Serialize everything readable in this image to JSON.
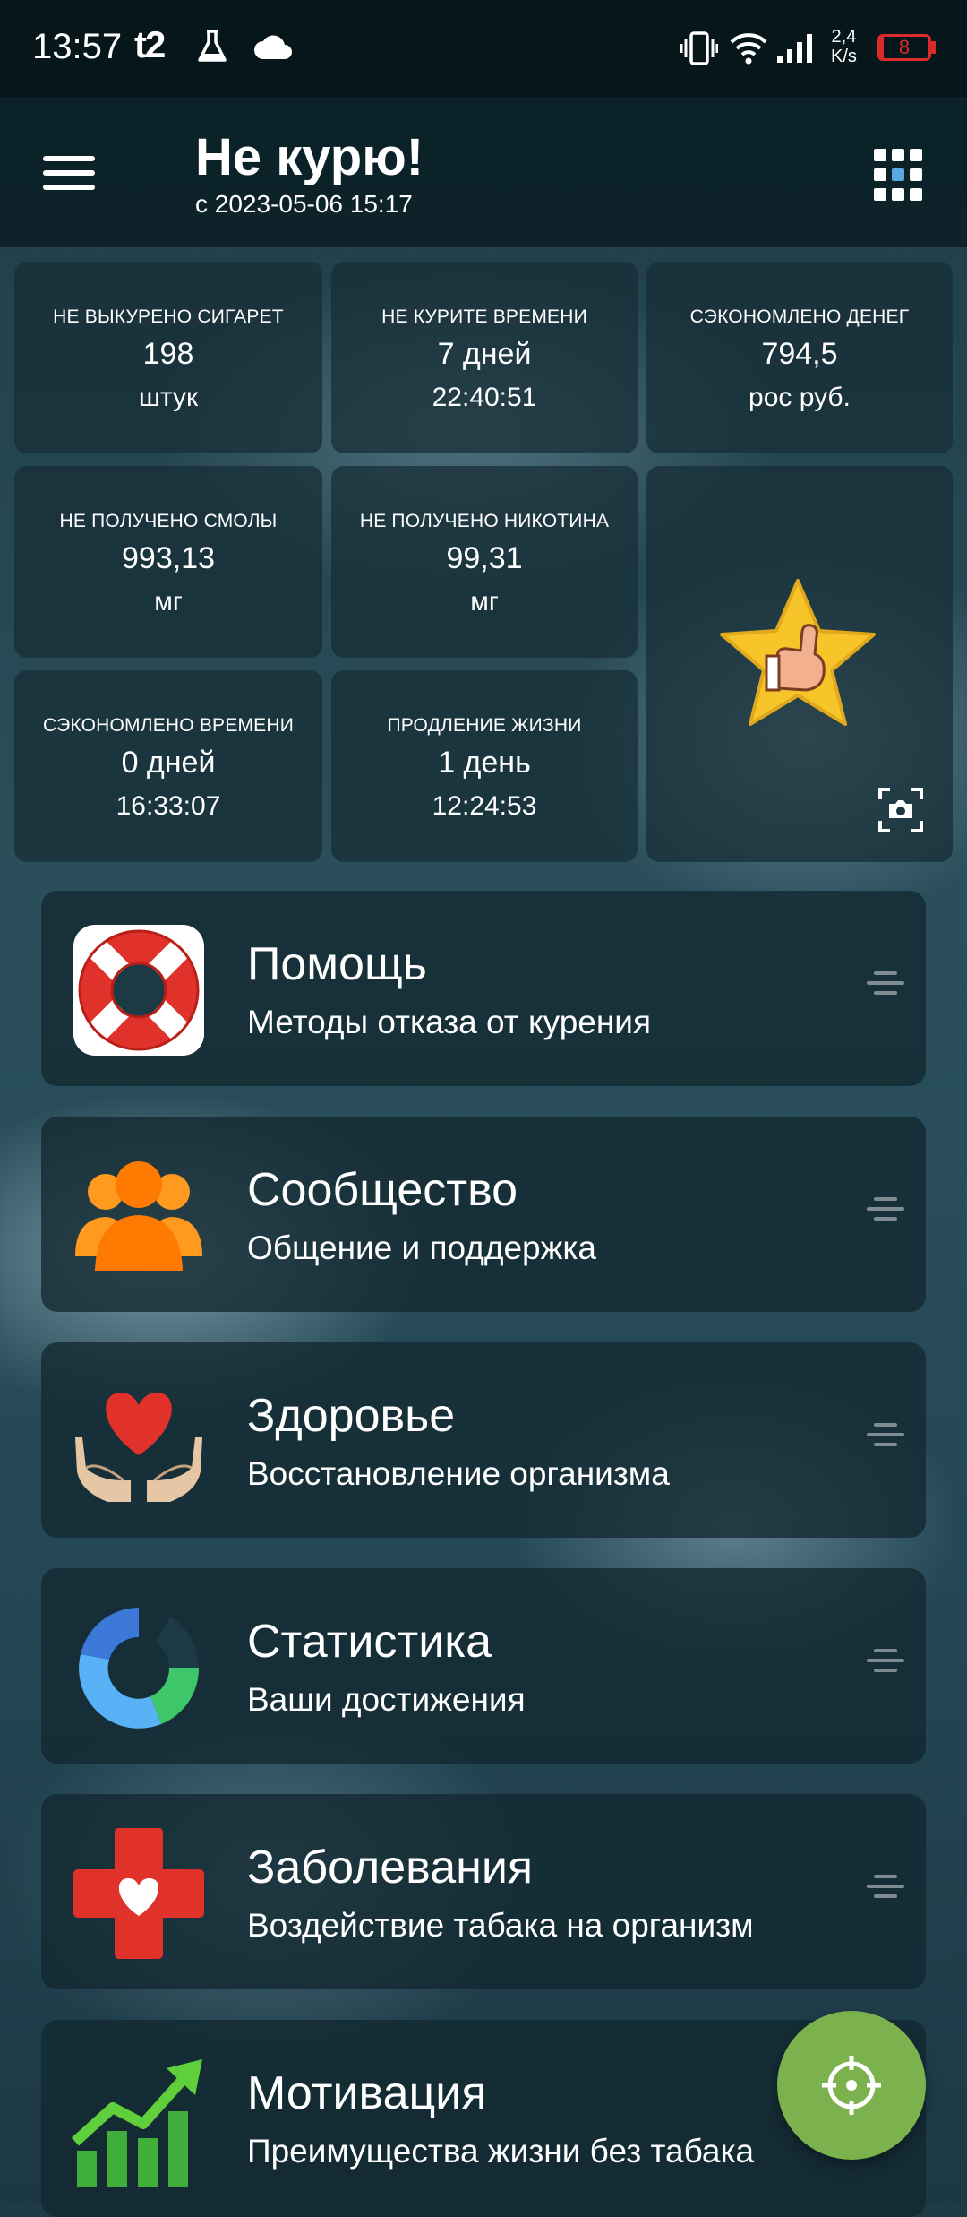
{
  "status_bar": {
    "time": "13:57",
    "carrier": "t2",
    "net_speed_value": "2,4",
    "net_speed_unit": "K/s",
    "battery_level": "8",
    "battery_color": "#d92b2b",
    "icons": [
      "lab-flask-icon",
      "cloud-icon",
      "vibrate-icon",
      "wifi-icon",
      "signal-icon",
      "battery-icon"
    ]
  },
  "header": {
    "title": "Не курю!",
    "since": "с 2023-05-06 15:17",
    "menu_icon": "hamburger-menu-icon",
    "grid_icon": "app-grid-icon"
  },
  "stats": [
    {
      "label": "НЕ ВЫКУРЕНО СИГАРЕТ",
      "value": "198",
      "unit": "штук"
    },
    {
      "label": "НЕ КУРИТЕ ВРЕМЕНИ",
      "value": "7 дней",
      "unit": "22:40:51"
    },
    {
      "label": "СЭКОНОМЛЕНО ДЕНЕГ",
      "value": "794,5",
      "unit": "рос руб."
    },
    {
      "label": "НЕ ПОЛУЧЕНО СМОЛЫ",
      "value": "993,13",
      "unit": "мг"
    },
    {
      "label": "НЕ ПОЛУЧЕНО НИКОТИНА",
      "value": "99,31",
      "unit": "мг"
    },
    {
      "label": "СЭКОНОМЛЕНО ВРЕМЕНИ",
      "value": "0 дней",
      "unit": "16:33:07"
    },
    {
      "label": "ПРОДЛЕНИЕ ЖИЗНИ",
      "value": "1 день",
      "unit": "12:24:53"
    }
  ],
  "achievement": {
    "icon": "star-flexed-arm-icon",
    "screenshot_icon": "camera-screenshot-icon"
  },
  "menu": [
    {
      "title": "Помощь",
      "subtitle": "Методы отказа от курения",
      "icon": "lifebuoy-icon"
    },
    {
      "title": "Сообщество",
      "subtitle": "Общение и поддержка",
      "icon": "people-group-icon"
    },
    {
      "title": "Здоровье",
      "subtitle": "Восстановление организма",
      "icon": "heart-in-hands-icon"
    },
    {
      "title": "Статистика",
      "subtitle": "Ваши достижения",
      "icon": "donut-stats-icon"
    },
    {
      "title": "Заболевания",
      "subtitle": "Воздействие табака на организм",
      "icon": "medical-cross-heart-icon"
    },
    {
      "title": "Мотивация",
      "subtitle": "Преимущества жизни без табака",
      "icon": "growth-chart-icon"
    }
  ],
  "fab": {
    "icon": "crosshair-target-icon",
    "color": "#7cb24d"
  }
}
